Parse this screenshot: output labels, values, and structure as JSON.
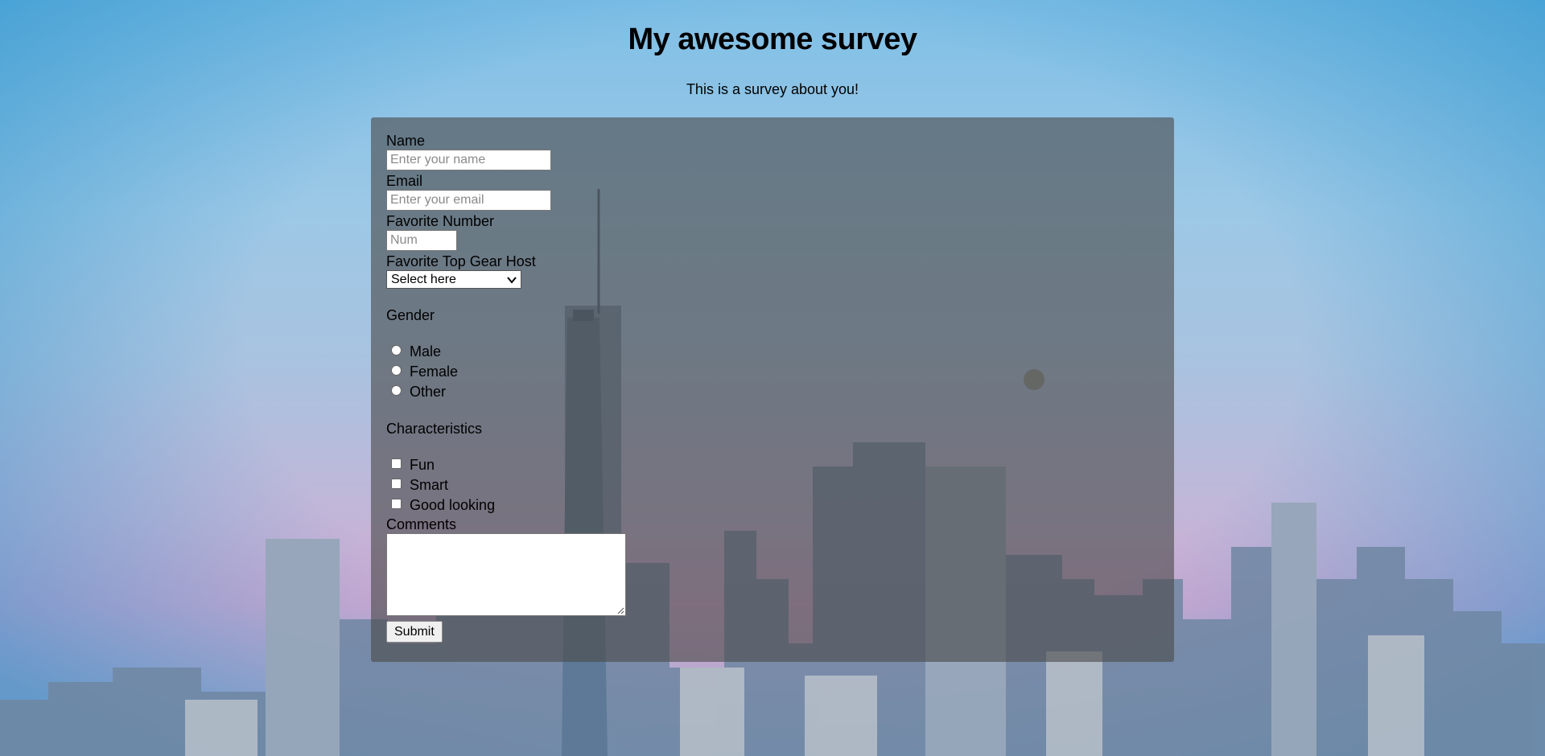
{
  "header": {
    "title": "My awesome survey",
    "subtitle": "This is a survey about you!"
  },
  "form": {
    "name": {
      "label": "Name",
      "placeholder": "Enter your name",
      "value": ""
    },
    "email": {
      "label": "Email",
      "placeholder": "Enter your email",
      "value": ""
    },
    "favorite_number": {
      "label": "Favorite Number",
      "placeholder": "Num",
      "value": ""
    },
    "top_gear_host": {
      "label": "Favorite Top Gear Host",
      "selected": "Select here"
    },
    "gender": {
      "label": "Gender",
      "options": [
        "Male",
        "Female",
        "Other"
      ]
    },
    "characteristics": {
      "label": "Characteristics",
      "options": [
        "Fun",
        "Smart",
        "Good looking"
      ]
    },
    "comments": {
      "label": "Comments",
      "value": ""
    },
    "submit_label": "Submit"
  },
  "colors": {
    "panel_overlay": "#4a4a4a",
    "sky_top": "#7fbfe6",
    "sky_bottom": "#d1a9d1"
  }
}
